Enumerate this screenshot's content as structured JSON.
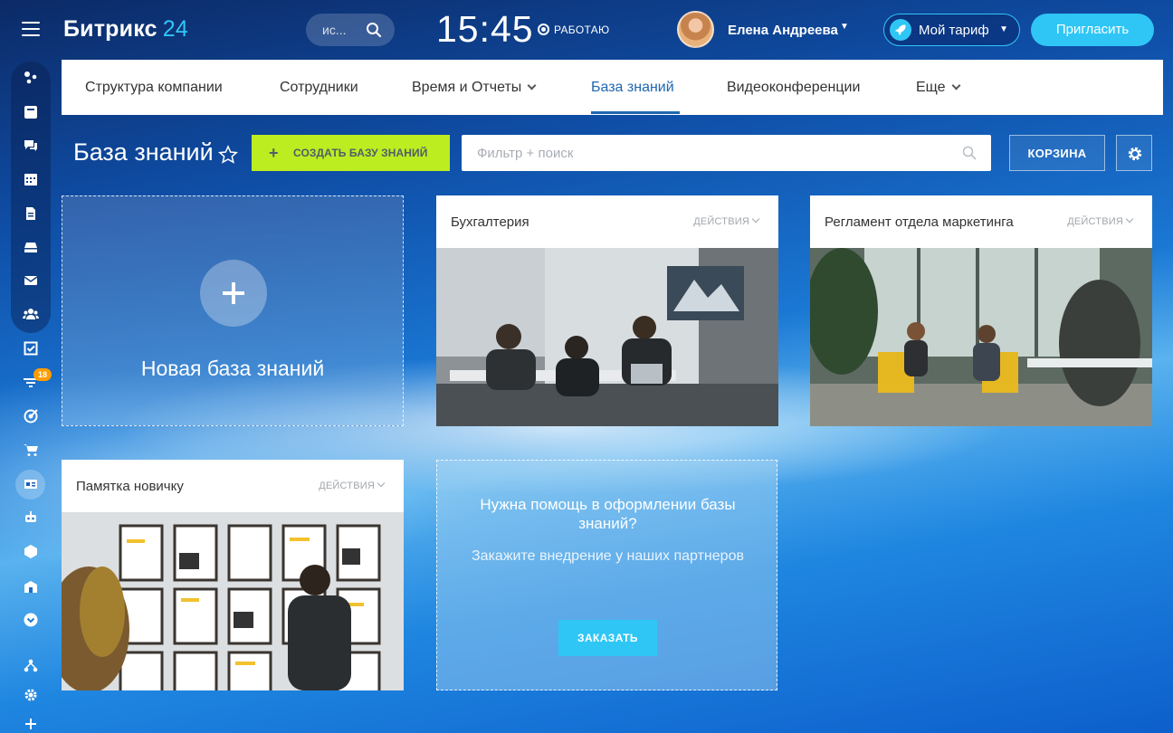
{
  "header": {
    "logo_name": "Битрикс",
    "logo_num": "24",
    "search_placeholder": "ис...",
    "clock": "15:45",
    "work_status": "РАБОТАЮ",
    "user_name": "Елена Андреева",
    "tariff_label": "Мой тариф",
    "invite_label": "Пригласить"
  },
  "sidebar": {
    "badge_count": "18",
    "icons": [
      "feed-icon",
      "chat-icon",
      "messenger-icon",
      "calendar-icon",
      "documents-icon",
      "drive-icon",
      "mail-icon",
      "groups-icon",
      "tasks-icon",
      "crm-funnel-icon",
      "marketing-icon",
      "shop-icon",
      "kb-icon",
      "robot-icon",
      "box-icon",
      "company-icon",
      "more-icon",
      "structure-icon",
      "settings-icon",
      "add-icon"
    ]
  },
  "nav": {
    "items": [
      {
        "label": "Структура компании"
      },
      {
        "label": "Сотрудники"
      },
      {
        "label": "Время и Отчеты"
      },
      {
        "label": "База знаний"
      },
      {
        "label": "Видеоконференции"
      },
      {
        "label": "Еще"
      }
    ]
  },
  "toolbar": {
    "page_title": "База знаний",
    "create_label": "СОЗДАТЬ БАЗУ ЗНАНИЙ",
    "filter_placeholder": "Фильтр + поиск",
    "trash_label": "КОРЗИНА"
  },
  "new_card": {
    "label": "Новая база знаний"
  },
  "cards": [
    {
      "title": "Бухгалтерия",
      "actions": "ДЕЙСТВИЯ"
    },
    {
      "title": "Регламент отдела маркетинга",
      "actions": "ДЕЙСТВИЯ"
    },
    {
      "title": "Памятка новичку",
      "actions": "ДЕЙСТВИЯ"
    }
  ],
  "help_card": {
    "title": "Нужна помощь в оформлении базы знаний?",
    "subtitle": "Закажите внедрение у наших партнеров",
    "button": "ЗАКАЗАТЬ"
  },
  "colors": {
    "accent": "#2fc6f6",
    "create_button": "#bbed21",
    "nav_active": "#2067b0",
    "badge": "#ff9d00"
  }
}
